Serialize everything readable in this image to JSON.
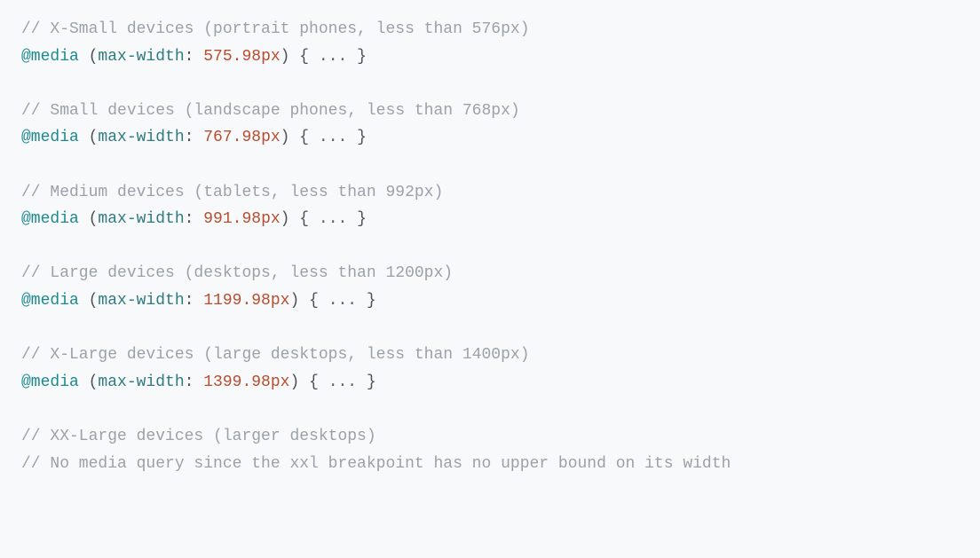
{
  "code": {
    "blocks": [
      {
        "comment": "// X-Small devices (portrait phones, less than 576px)",
        "atrule": "@media",
        "open_paren": " (",
        "property": "max-width",
        "colon": ": ",
        "number": "575.98",
        "unit": "px",
        "close_paren": ")",
        "space_brace_open": " { ",
        "ellipsis": "...",
        "space_brace_close": " }"
      },
      {
        "comment": "// Small devices (landscape phones, less than 768px)",
        "atrule": "@media",
        "open_paren": " (",
        "property": "max-width",
        "colon": ": ",
        "number": "767.98",
        "unit": "px",
        "close_paren": ")",
        "space_brace_open": " { ",
        "ellipsis": "...",
        "space_brace_close": " }"
      },
      {
        "comment": "// Medium devices (tablets, less than 992px)",
        "atrule": "@media",
        "open_paren": " (",
        "property": "max-width",
        "colon": ": ",
        "number": "991.98",
        "unit": "px",
        "close_paren": ")",
        "space_brace_open": " { ",
        "ellipsis": "...",
        "space_brace_close": " }"
      },
      {
        "comment": "// Large devices (desktops, less than 1200px)",
        "atrule": "@media",
        "open_paren": " (",
        "property": "max-width",
        "colon": ": ",
        "number": "1199.98",
        "unit": "px",
        "close_paren": ")",
        "space_brace_open": " { ",
        "ellipsis": "...",
        "space_brace_close": " }"
      },
      {
        "comment": "// X-Large devices (large desktops, less than 1400px)",
        "atrule": "@media",
        "open_paren": " (",
        "property": "max-width",
        "colon": ": ",
        "number": "1399.98",
        "unit": "px",
        "close_paren": ")",
        "space_brace_open": " { ",
        "ellipsis": "...",
        "space_brace_close": " }"
      }
    ],
    "trailing_comments": [
      "// XX-Large devices (larger desktops)",
      "// No media query since the xxl breakpoint has no upper bound on its width"
    ]
  }
}
